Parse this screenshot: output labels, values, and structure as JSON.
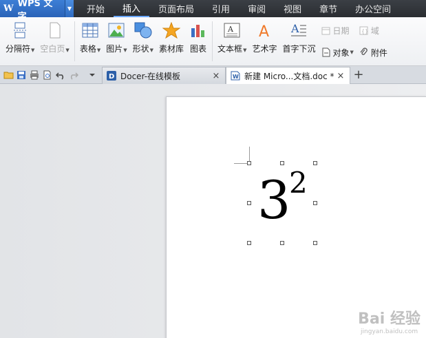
{
  "app": {
    "logo": "W",
    "title": "WPS 文字"
  },
  "menu": {
    "tabs": [
      "开始",
      "插入",
      "页面布局",
      "引用",
      "审阅",
      "视图",
      "章节",
      "办公空间"
    ],
    "active_index": 1
  },
  "ribbon": {
    "page_break": "分隔符",
    "blank_page": "空白页",
    "table": "表格",
    "picture": "图片",
    "shape": "形状",
    "material": "素材库",
    "chart": "图表",
    "textbox": "文本框",
    "wordart": "艺术字",
    "dropcap": "首字下沉",
    "date": "日期",
    "field": "域",
    "object": "对象",
    "attachment": "附件"
  },
  "doc_tabs": [
    {
      "title": "Docer-在线模板",
      "close": "×"
    },
    {
      "title": "新建 Micro...文档.doc *",
      "close": "×"
    }
  ],
  "add_tab": "+",
  "document": {
    "base": "3",
    "exponent": "2"
  },
  "watermark": {
    "line1": "Bai 经验",
    "line2": "jingyan.baidu.com"
  },
  "colors": {
    "accent": "#3d7fd6",
    "menubar": "#2a2d31",
    "ribbon": "#f4f5f7"
  }
}
